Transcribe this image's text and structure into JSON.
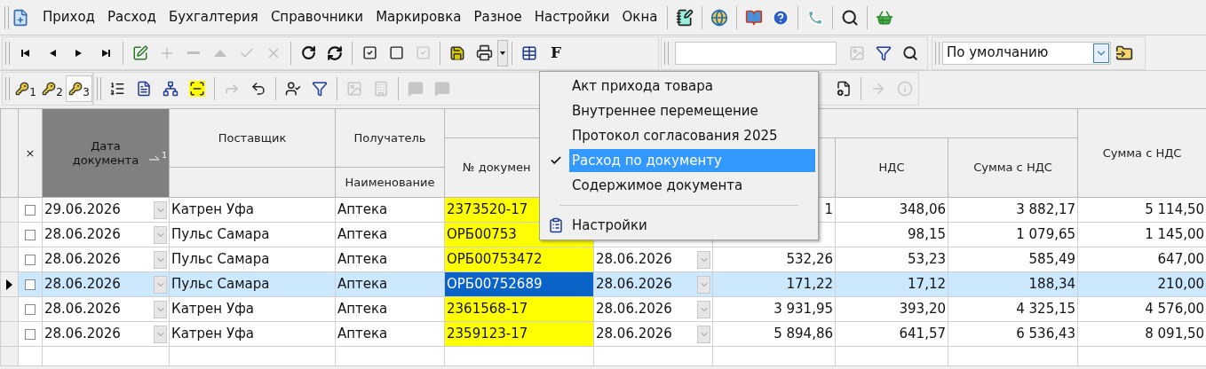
{
  "menu_bar": {
    "items": [
      "Приход",
      "Расход",
      "Бухгалтерия",
      "Справочники",
      "Маркировка",
      "Разное",
      "Настройки",
      "Окна"
    ]
  },
  "toolbar1": {
    "groups": [
      [
        {
          "disabled": false
        },
        {
          "disabled": false
        },
        {
          "disabled": false
        },
        {
          "disabled": false
        }
      ],
      [
        {
          "disabled": false
        },
        {
          "disabled": true
        },
        {
          "disabled": true
        },
        {
          "disabled": true
        },
        {
          "disabled": true
        },
        {
          "disabled": true
        }
      ],
      [
        {
          "disabled": false
        },
        {
          "disabled": false
        }
      ],
      [
        {
          "disabled": false
        },
        {
          "disabled": false
        },
        {
          "disabled": true
        }
      ],
      [
        {
          "disabled": false
        },
        {
          "disabled": false
        }
      ]
    ],
    "f_button": "F",
    "combo": {
      "value": "По умолчанию"
    }
  },
  "toolbar2": {
    "keys": [
      {
        "label": "1",
        "selected": false
      },
      {
        "label": "2",
        "selected": false
      },
      {
        "label": "3",
        "selected": true
      }
    ],
    "groups": [
      [
        {
          "disabled": false
        },
        {
          "disabled": false
        },
        {
          "disabled": false
        },
        {
          "disabled": false
        }
      ],
      [
        {
          "disabled": true
        },
        {
          "disabled": false
        }
      ],
      [
        {
          "disabled": false
        },
        {
          "disabled": false
        }
      ],
      [
        {
          "disabled": true
        },
        {
          "disabled": true
        }
      ],
      [
        {
          "disabled": true
        },
        {
          "disabled": true
        }
      ]
    ],
    "right": [
      {
        "disabled": false
      },
      {
        "disabled": true
      },
      {
        "disabled": true
      }
    ]
  },
  "dropdown_menu": {
    "items": [
      {
        "kind": "item",
        "label": "Акт прихода товара",
        "checked": false,
        "selected": false
      },
      {
        "kind": "item",
        "label": "Внутреннее перемещение",
        "checked": false,
        "selected": false
      },
      {
        "kind": "item",
        "label": "Протокол согласования 2025",
        "checked": false,
        "selected": false
      },
      {
        "kind": "item",
        "label": "Расход по документу",
        "checked": true,
        "selected": true
      },
      {
        "kind": "item",
        "label": "Содержимое документа",
        "checked": false,
        "selected": false
      },
      {
        "kind": "separator"
      },
      {
        "kind": "icon_item",
        "label": "Настройки",
        "checked": false,
        "selected": false
      }
    ]
  },
  "table": {
    "columns": {
      "mark": "×",
      "date": "Дата документа",
      "date_sort": "1",
      "supplier": "Поставщик",
      "recipient": "Получатель",
      "recipient_sub": "Наименование",
      "doc_number": "№ докумен",
      "vat": "НДС",
      "sum_vat": "Сумма с НДС",
      "total": "Сумма с НДС"
    },
    "rows": [
      {
        "selected": false,
        "checked": false,
        "date": "29.06.2026",
        "supplier": "Катрен Уфа",
        "recipient": "Аптека",
        "doc_number": "2373520-17",
        "date2": "",
        "sum": "1",
        "vat": "348,06",
        "sum_vat": "3 882,17",
        "total": "5 114,50"
      },
      {
        "selected": false,
        "checked": false,
        "date": "28.06.2026",
        "supplier": "Пульс Самара",
        "recipient": "Аптека",
        "doc_number": "ОРБ00753",
        "date2": "",
        "sum": "",
        "vat": "98,15",
        "sum_vat": "1 079,65",
        "total": "1 145,00"
      },
      {
        "selected": false,
        "checked": false,
        "date": "28.06.2026",
        "supplier": "Пульс Самара",
        "recipient": "Аптека",
        "doc_number": "ОРБ00753472",
        "date2": "28.06.2026",
        "sum": "532,26",
        "vat": "53,23",
        "sum_vat": "585,49",
        "total": "647,00"
      },
      {
        "selected": true,
        "checked": false,
        "date": "28.06.2026",
        "supplier": "Пульс Самара",
        "recipient": "Аптека",
        "doc_number": "ОРБ00752689",
        "date2": "28.06.2026",
        "sum": "171,22",
        "vat": "17,12",
        "sum_vat": "188,34",
        "total": "210,00"
      },
      {
        "selected": false,
        "checked": false,
        "date": "28.06.2026",
        "supplier": "Катрен Уфа",
        "recipient": "Аптека",
        "doc_number": "2361568-17",
        "date2": "28.06.2026",
        "sum": "3 931,95",
        "vat": "393,20",
        "sum_vat": "4 325,15",
        "total": "4 576,00"
      },
      {
        "selected": false,
        "checked": false,
        "date": "28.06.2026",
        "supplier": "Катрен Уфа",
        "recipient": "Аптека",
        "doc_number": "2359123-17",
        "date2": "28.06.2026",
        "sum": "5 894,86",
        "vat": "641,57",
        "sum_vat": "6 536,43",
        "total": "8 091,50"
      }
    ]
  }
}
